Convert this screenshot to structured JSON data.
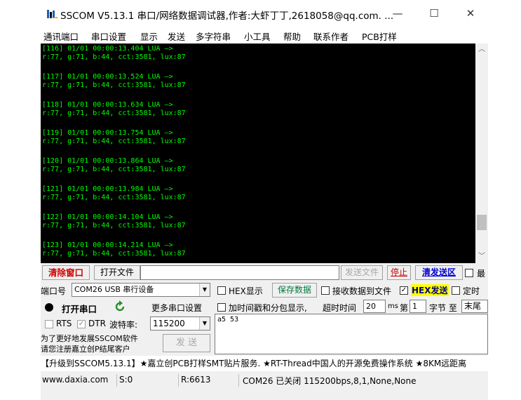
{
  "window": {
    "title": "SSCOM V5.13.1 串口/网络数据调试器,作者:大虾丁丁,2618058@qq.com. ...",
    "minimize": "—",
    "maximize": "☐",
    "close": "✕"
  },
  "menu": [
    "通讯端口",
    "串口设置",
    "显示",
    "发送",
    "多字符串",
    "小工具",
    "帮助",
    "联系作者",
    "PCB打样"
  ],
  "terminal": [
    {
      "head": "[116] 01/01 00:00:13.404 LUA —>",
      "data": "r:77, g:71, b:44, cct:3581, lux:87"
    },
    {
      "head": "[117] 01/01 00:00:13.524 LUA —>",
      "data": "r:77, g:71, b:44, cct:3581, lux:87"
    },
    {
      "head": "[118] 01/01 00:00:13.634 LUA —>",
      "data": "r:77, g:71, b:44, cct:3581, lux:87"
    },
    {
      "head": "[119] 01/01 00:00:13.754 LUA —>",
      "data": "r:77, g:71, b:44, cct:3581, lux:87"
    },
    {
      "head": "[120] 01/01 00:00:13.864 LUA —>",
      "data": "r:77, g:71, b:44, cct:3581, lux:87"
    },
    {
      "head": "[121] 01/01 00:00:13.984 LUA —>",
      "data": "r:77, g:71, b:44, cct:3581, lux:87"
    },
    {
      "head": "[122] 01/01 00:00:14.104 LUA —>",
      "data": "r:77, g:71, b:44, cct:3581, lux:87"
    },
    {
      "head": "[123] 01/01 00:00:14.214 LUA —>",
      "data": "r:77, g:71, b:44, cct:3581, lux:87"
    }
  ],
  "toolbar1": {
    "clear_window": "清除窗口",
    "open_file": "打开文件",
    "file_path": "",
    "send_file": "发送文件",
    "stop": "停止",
    "clear_send": "清发送区",
    "last_label": "最"
  },
  "port_row": {
    "port_label": "端口号",
    "port_value": "COM26 USB 串行设备",
    "hex_display": "HEX显示",
    "save_data": "保存数据",
    "recv_to_file": "接收数据到文件",
    "hex_send": "HEX发送",
    "timed": "定时"
  },
  "open_row": {
    "open_port": "打开串口",
    "more_settings": "更多串口设置",
    "timestamp_label": "加时间戳和分包显示,",
    "timeout_label": "超时时间",
    "timeout_value": "20",
    "timeout_unit": "ms",
    "byte_prefix": "第",
    "byte_index": "1",
    "byte_label": "字节 至",
    "byte_end": "末尾"
  },
  "rts_row": {
    "rts": "RTS",
    "dtr": "DTR",
    "baud_label": "波特率:",
    "baud_value": "115200"
  },
  "send_box": {
    "content": "a5 53"
  },
  "promo": {
    "line1": "为了更好地发展SSCOM软件",
    "line2": "请您注册嘉立创P结尾客户",
    "send": "发 送"
  },
  "ticker": "【升级到SSCOM5.13.1】★嘉立创PCB打样SMT贴片服务. ★RT-Thread中国人的开源免费操作系统 ★8KM远距离",
  "status": {
    "site": "www.daxia.com",
    "sent": "S:0",
    "received": "R:6613",
    "port_state": "COM26 已关闭  115200bps,8,1,None,None"
  },
  "colors": {
    "terminal_bg": "#000000",
    "terminal_text": "#00ff00",
    "accent_red": "#d00000",
    "link_blue": "#0000d0",
    "save_green": "#007a3d"
  },
  "icons": {
    "app": "sscom-logo-icon",
    "refresh": "refresh-icon",
    "port_state": "record-dot-icon"
  }
}
